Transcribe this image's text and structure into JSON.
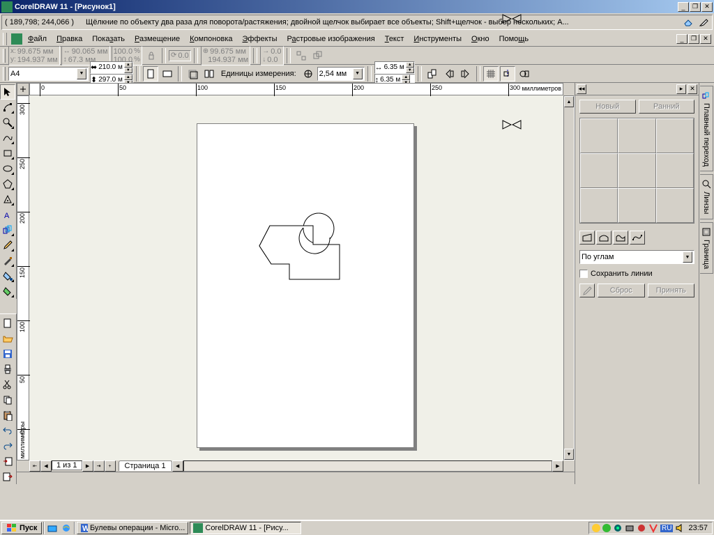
{
  "title": "CorelDRAW 11 - [Рисунок1]",
  "statusbar": {
    "coords": "( 189,798; 244,066 )",
    "hint": "Щёлкние по объекту два раза для поворота/растяжения; двойной щелчок выбирает все объекты; Shift+щелчок - выбор нескольких; A..."
  },
  "menu": {
    "file": "Файл",
    "edit": "Правка",
    "view": "Показать",
    "layout": "Размещение",
    "arrange": "Компоновка",
    "effects": "Эффекты",
    "bitmaps": "Растровые изображения",
    "text": "Текст",
    "tools": "Инструменты",
    "window": "Окно",
    "help": "Помощь"
  },
  "propbar": {
    "x": "99.675 мм",
    "y": "194.937 мм",
    "w": "90.065 мм",
    "h": "67.3 мм",
    "sx": "100.0",
    "sy": "100.0",
    "rot": "0.0",
    "x2": "99.675 мм",
    "y2": "194.937 мм",
    "ox": "0.0",
    "oy": "0.0"
  },
  "pagebar": {
    "size": "A4",
    "pw": "210.0 м",
    "ph": "297.0 м",
    "units_label": "Единицы измерения:",
    "units_val": "2,54 мм",
    "nx": "6.35 м",
    "ny": "6.35 м"
  },
  "ruler": {
    "units": "миллиметров",
    "units_v": "миллиметры",
    "top_ticks": [
      0,
      50,
      100,
      150,
      200,
      250,
      300
    ],
    "left_ticks": [
      300,
      250,
      200,
      150,
      100,
      50,
      0
    ]
  },
  "pagenav": {
    "count": "1 из 1",
    "tab": "Страница 1"
  },
  "docker": {
    "new_btn": "Новый",
    "early_btn": "Ранний",
    "mode": "По углам",
    "keep_lines": "Сохранить линии",
    "reset": "Сброс",
    "apply": "Принять",
    "tabs": {
      "blend": "Плавный переход",
      "lens": "Линзы",
      "border": "Граница"
    }
  },
  "taskbar": {
    "start": "Пуск",
    "task1": "Булевы операции - Micro...",
    "task2": "CorelDRAW 11 - [Рису...",
    "lang": "RU",
    "clock": "23:57"
  }
}
